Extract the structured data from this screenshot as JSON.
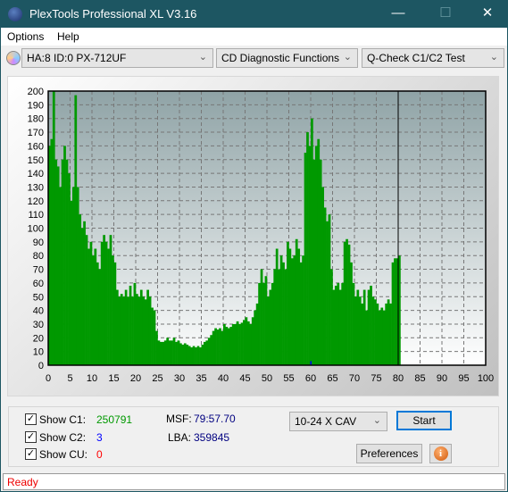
{
  "window": {
    "title": "PlexTools Professional XL V3.16",
    "app_icon_text": "XL"
  },
  "menu": [
    {
      "label": "Options"
    },
    {
      "label": "Help"
    }
  ],
  "toolbar": {
    "drive": "HA:8 ID:0  PX-712UF",
    "function": "CD Diagnostic Functions",
    "test": "Q-Check C1/C2 Test"
  },
  "controls": {
    "show_c1_label": "Show C1:",
    "c1_value": "250791",
    "show_c1": true,
    "show_c2_label": "Show C2:",
    "c2_value": "3",
    "show_c2": true,
    "show_cu_label": "Show CU:",
    "cu_value": "0",
    "show_cu": true,
    "msf_label": "MSF:",
    "msf_value": "79:57.70",
    "lba_label": "LBA:",
    "lba_value": "359845",
    "speed": "10-24 X CAV",
    "start_label": "Start",
    "preferences_label": "Preferences"
  },
  "colors": {
    "c1": "#009900",
    "c2": "#0000ff",
    "cu": "#ff0000",
    "title_bar": "#1d5662"
  },
  "status": "Ready",
  "chart_data": {
    "type": "bar",
    "xlim": [
      0,
      100
    ],
    "ylim": [
      0,
      200
    ],
    "x_ticks": [
      "0",
      "5",
      "10",
      "15",
      "20",
      "25",
      "30",
      "35",
      "40",
      "45",
      "50",
      "55",
      "60",
      "65",
      "70",
      "75",
      "80",
      "85",
      "90",
      "95",
      "100"
    ],
    "y_ticks": [
      "0",
      "10",
      "20",
      "30",
      "40",
      "50",
      "60",
      "70",
      "80",
      "90",
      "100",
      "110",
      "120",
      "130",
      "140",
      "150",
      "160",
      "170",
      "180",
      "190",
      "200"
    ],
    "grid": true,
    "x_step": 0.5,
    "progress_marker": 80,
    "series": [
      {
        "values": [
          160,
          165,
          200,
          150,
          145,
          130,
          150,
          160,
          150,
          140,
          120,
          130,
          197,
          130,
          110,
          100,
          105,
          95,
          85,
          90,
          80,
          85,
          75,
          70,
          90,
          95,
          90,
          85,
          95,
          80,
          75,
          55,
          50,
          52,
          50,
          55,
          50,
          58,
          50,
          60,
          52,
          50,
          55,
          50,
          48,
          55,
          50,
          42,
          40,
          25,
          18,
          17,
          17,
          18,
          20,
          18,
          18,
          20,
          17,
          18,
          16,
          15,
          16,
          15,
          14,
          13,
          14,
          13,
          14,
          13,
          15,
          17,
          18,
          20,
          22,
          25,
          27,
          26,
          27,
          25,
          30,
          28,
          27,
          28,
          30,
          30,
          32,
          30,
          31,
          33,
          35,
          32,
          30,
          35,
          40,
          45,
          60,
          70,
          60,
          65,
          50,
          55,
          60,
          70,
          85,
          70,
          80,
          75,
          70,
          90,
          85,
          78,
          80,
          92,
          85,
          75,
          80,
          155,
          170,
          160,
          180,
          150,
          160,
          165,
          150,
          130,
          115,
          105,
          110,
          70,
          55,
          58,
          60,
          55,
          60,
          90,
          92,
          88,
          75,
          60,
          50,
          55,
          50,
          45,
          55,
          40,
          55,
          58,
          50,
          48,
          45,
          40,
          42,
          40,
          45,
          48,
          45,
          75,
          78,
          78,
          80
        ]
      },
      {
        "c2_points": [
          {
            "x": 60,
            "y": 3
          }
        ]
      }
    ]
  }
}
